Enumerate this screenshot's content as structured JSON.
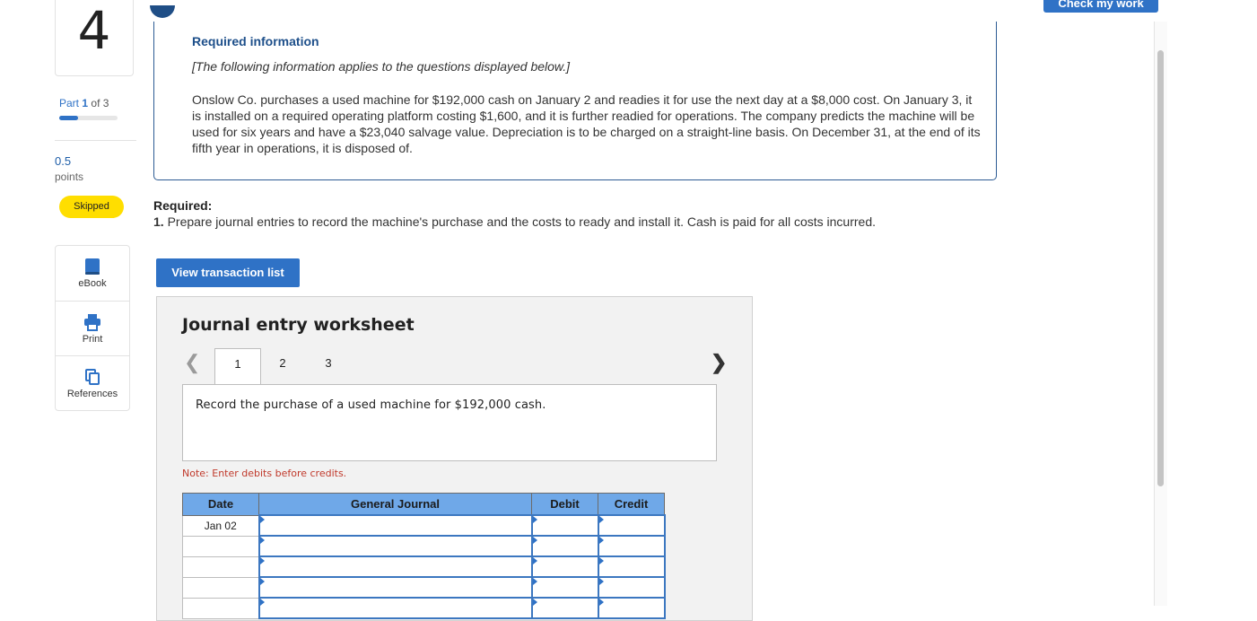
{
  "header": {
    "check_label": "Check my work"
  },
  "question": {
    "number": "4",
    "part_label": "Part",
    "part_current": "1",
    "part_of": "of 3",
    "part_progress": 0.33,
    "points_value": "0.5",
    "points_label": "points",
    "status_badge": "Skipped"
  },
  "tools": [
    {
      "label": "eBook",
      "icon": "book-icon"
    },
    {
      "label": "Print",
      "icon": "printer-icon"
    },
    {
      "label": "References",
      "icon": "copy-icon"
    }
  ],
  "info": {
    "heading": "Required information",
    "subheading": "[The following information applies to the questions displayed below.]",
    "body": "Onslow Co. purchases a used machine for $192,000 cash on January 2 and readies it for use the next day at a $8,000 cost. On January 3, it is installed on a required operating platform costing $1,600, and it is further readied for operations. The company predicts the machine will be used for six years and have a $23,040 salvage value. Depreciation is to be charged on a straight-line basis. On December 31, at the end of its fifth year in operations, it is disposed of."
  },
  "required": {
    "heading": "Required:",
    "number": "1.",
    "text": " Prepare journal entries to record the machine's purchase and the costs to ready and install it. Cash is paid for all costs incurred."
  },
  "view_button": "View transaction list",
  "worksheet": {
    "title": "Journal entry worksheet",
    "tabs": [
      "1",
      "2",
      "3"
    ],
    "active_tab": "1",
    "description": "Record the purchase of a used machine for $192,000 cash.",
    "note": "Note: Enter debits before credits.",
    "columns": [
      "Date",
      "General Journal",
      "Debit",
      "Credit"
    ],
    "rows": [
      {
        "date": "Jan 02"
      },
      {
        "date": ""
      },
      {
        "date": ""
      },
      {
        "date": ""
      },
      {
        "date": ""
      }
    ]
  }
}
